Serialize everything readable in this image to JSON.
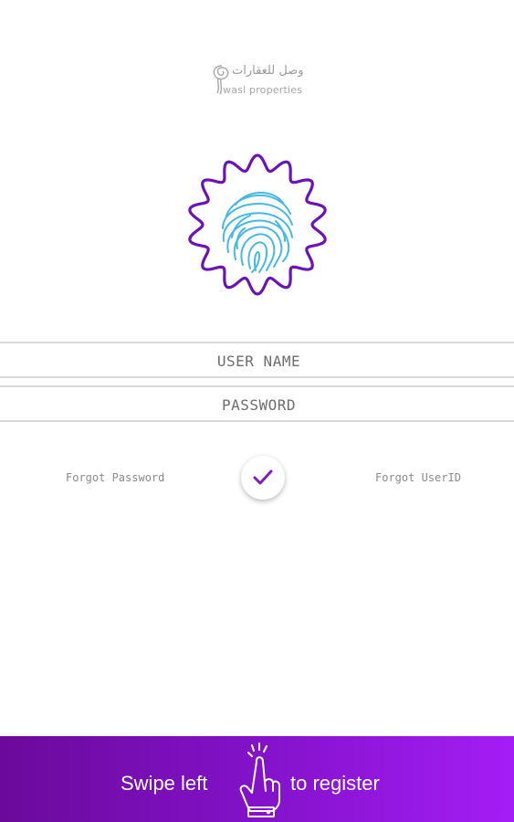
{
  "brand": {
    "arabic_name": "وصل للعقارات",
    "latin_name": "wasl properties"
  },
  "login": {
    "username_placeholder": "USER NAME",
    "password_placeholder": "PASSWORD",
    "forgot_password": "Forgot Password",
    "forgot_userid": "Forgot UserID"
  },
  "swipe": {
    "left_text": "Swipe left",
    "right_text": "to register"
  },
  "icons": {
    "logo": "wasl-logo-icon",
    "badge": "fingerprint-icon",
    "submit": "checkmark-icon",
    "swipe": "swipe-hand-icon"
  },
  "colors": {
    "accent": "#7b1fc1",
    "fingerprint": "#3fb6dd",
    "bar_start": "#6a0a9a",
    "bar_end": "#a41df5"
  }
}
